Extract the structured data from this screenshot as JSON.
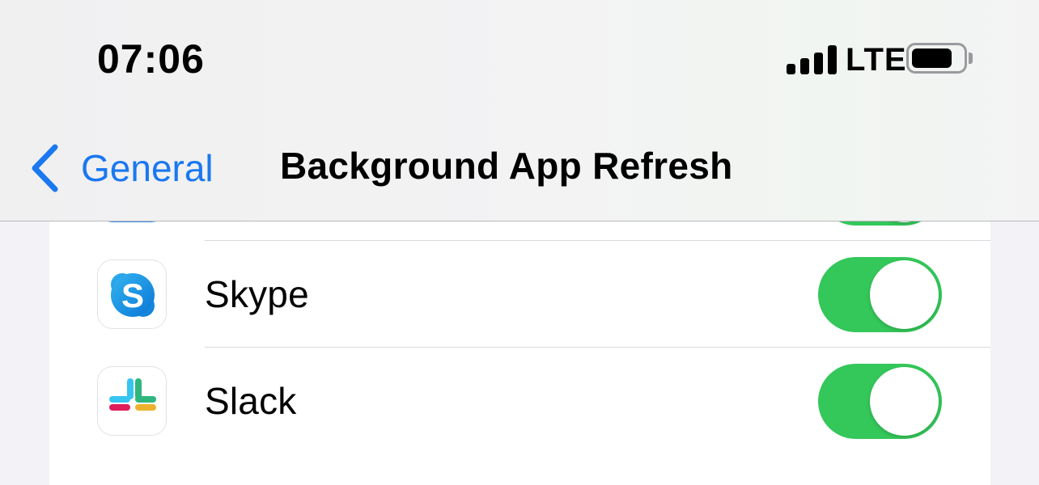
{
  "status_bar": {
    "time": "07:06",
    "network": "LTE",
    "battery_level": 0.8,
    "signal_bars": 4
  },
  "nav": {
    "back_label": "General",
    "title": "Background App Refresh"
  },
  "apps": [
    {
      "name": "",
      "icon": "app-icon-partial",
      "enabled": true
    },
    {
      "name": "Skype",
      "icon": "skype-icon",
      "enabled": true
    },
    {
      "name": "Slack",
      "icon": "slack-icon",
      "enabled": true
    }
  ],
  "colors": {
    "accent_blue": "#1a78f0",
    "toggle_on": "#34c759",
    "background": "#f2f2f7"
  }
}
